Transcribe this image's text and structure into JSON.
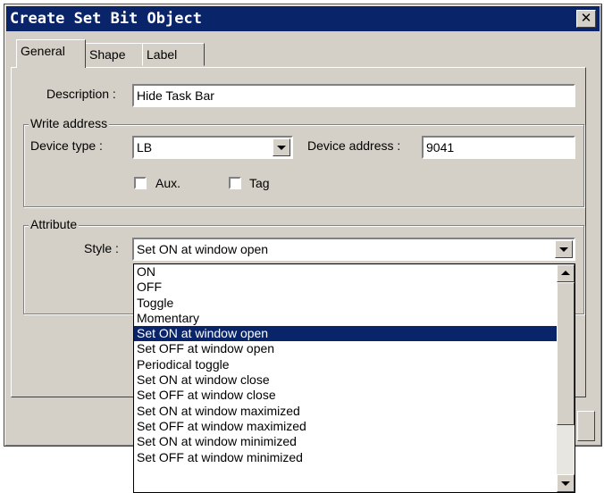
{
  "dialog": {
    "title": "Create Set Bit  Object"
  },
  "tabs": [
    {
      "label": "General"
    },
    {
      "label": "Shape"
    },
    {
      "label": "Label"
    }
  ],
  "general": {
    "description_label": "Description :",
    "description_value": "Hide Task Bar",
    "write_address": {
      "group_label": "Write address",
      "device_type_label": "Device type :",
      "device_type_value": "LB",
      "device_address_label": "Device address :",
      "device_address_value": "9041",
      "aux_label": "Aux.",
      "tag_label": "Tag"
    },
    "attribute": {
      "group_label": "Attribute",
      "style_label": "Style :",
      "style_value": "Set ON at window open",
      "options": [
        "ON",
        "OFF",
        "Toggle",
        "Momentary",
        "Set ON at window open",
        "Set OFF at window open",
        "Periodical toggle",
        "Set ON at window close",
        "Set OFF at window close",
        "Set ON at window maximized",
        "Set OFF at window maximized",
        "Set ON at window minimized",
        "Set OFF at window minimized"
      ],
      "selected_index": 4
    }
  }
}
